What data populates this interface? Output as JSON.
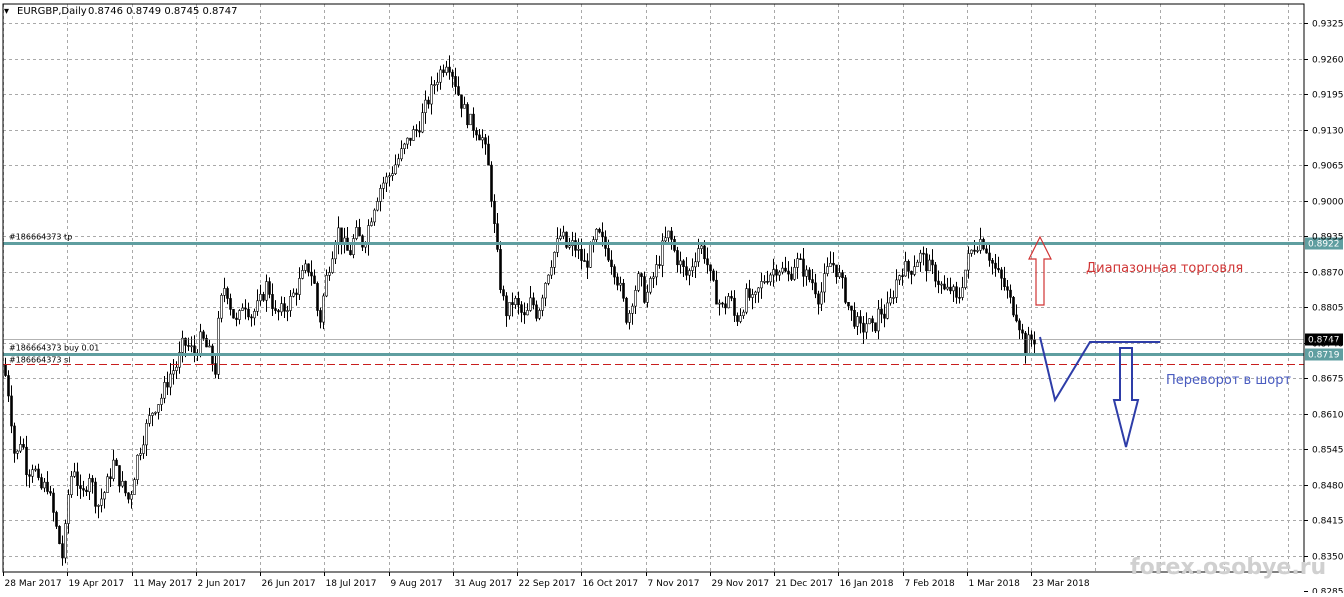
{
  "header": {
    "arrow": "▾",
    "symbol": "EURGBP,Daily",
    "ohlc": "0.8746 0.8749 0.8745 0.8747"
  },
  "watermark": "forex.osobye.ru",
  "annotations": {
    "range_label": "Диапазонная торговля",
    "short_label": "Переворот в шорт"
  },
  "order_labels": {
    "tp": "#186664373 tp",
    "buy": "#186664373 buy 0.01",
    "sl": "#186664373 sl"
  },
  "colors": {
    "background": "#ffffff",
    "grid": "#a9a9a9",
    "candle": "#000000",
    "level_line": "#5f9ea0",
    "sl_line": "#c81e1e",
    "price_tag": "#000000",
    "level_tag": "#5f9ea0",
    "range_label": "#d03434",
    "short_label": "#4a5cc0",
    "drawing_blue": "#2e3da8",
    "drawing_red": "#d03434",
    "watermark": "#c8c8c8"
  },
  "chart_data": {
    "type": "candlestick",
    "symbol": "EURGBP",
    "timeframe": "Daily",
    "ylim": [
      0.832,
      0.936
    ],
    "y_ticks": [
      "0.9325",
      "0.9260",
      "0.9195",
      "0.9130",
      "0.9065",
      "0.9000",
      "0.8935",
      "0.8870",
      "0.8805",
      "0.8740",
      "0.8675",
      "0.8610",
      "0.8545",
      "0.8480",
      "0.8415",
      "0.8350",
      "0.8285"
    ],
    "x_ticks": [
      "28 Mar 2017",
      "19 Apr 2017",
      "11 May 2017",
      "2 Jun 2017",
      "26 Jun 2017",
      "18 Jul 2017",
      "9 Aug 2017",
      "31 Aug 2017",
      "22 Sep 2017",
      "16 Oct 2017",
      "7 Nov 2017",
      "29 Nov 2017",
      "21 Dec 2017",
      "16 Jan 2018",
      "7 Feb 2018",
      "1 Mar 2018",
      "23 Mar 2018"
    ],
    "current_price": "0.8747",
    "levels": [
      {
        "name": "tp",
        "price": 0.8922,
        "tag": "0.8922"
      },
      {
        "name": "buy",
        "price": 0.8719,
        "tag": "0.8719"
      },
      {
        "name": "sl",
        "price": 0.87
      }
    ],
    "path_points": [
      [
        0,
        0.87
      ],
      [
        6,
        0.864
      ],
      [
        12,
        0.852
      ],
      [
        18,
        0.857
      ],
      [
        24,
        0.85
      ],
      [
        30,
        0.852
      ],
      [
        36,
        0.847
      ],
      [
        44,
        0.848
      ],
      [
        54,
        0.839
      ],
      [
        60,
        0.834
      ],
      [
        64,
        0.845
      ],
      [
        70,
        0.852
      ],
      [
        78,
        0.845
      ],
      [
        86,
        0.85
      ],
      [
        94,
        0.844
      ],
      [
        102,
        0.847
      ],
      [
        110,
        0.852
      ],
      [
        118,
        0.848
      ],
      [
        126,
        0.845
      ],
      [
        134,
        0.853
      ],
      [
        142,
        0.858
      ],
      [
        150,
        0.862
      ],
      [
        158,
        0.864
      ],
      [
        166,
        0.868
      ],
      [
        174,
        0.87
      ],
      [
        180,
        0.874
      ],
      [
        186,
        0.873
      ],
      [
        192,
        0.872
      ],
      [
        198,
        0.875
      ],
      [
        206,
        0.872
      ],
      [
        212,
        0.869
      ],
      [
        216,
        0.88
      ],
      [
        222,
        0.885
      ],
      [
        228,
        0.88
      ],
      [
        234,
        0.877
      ],
      [
        240,
        0.882
      ],
      [
        248,
        0.879
      ],
      [
        256,
        0.881
      ],
      [
        264,
        0.885
      ],
      [
        272,
        0.879
      ],
      [
        280,
        0.88
      ],
      [
        288,
        0.882
      ],
      [
        296,
        0.885
      ],
      [
        304,
        0.888
      ],
      [
        310,
        0.886
      ],
      [
        316,
        0.877
      ],
      [
        322,
        0.885
      ],
      [
        328,
        0.89
      ],
      [
        334,
        0.895
      ],
      [
        340,
        0.892
      ],
      [
        346,
        0.89
      ],
      [
        352,
        0.894
      ],
      [
        360,
        0.892
      ],
      [
        366,
        0.896
      ],
      [
        372,
        0.9
      ],
      [
        378,
        0.903
      ],
      [
        384,
        0.904
      ],
      [
        390,
        0.906
      ],
      [
        396,
        0.908
      ],
      [
        402,
        0.91
      ],
      [
        408,
        0.912
      ],
      [
        414,
        0.913
      ],
      [
        420,
        0.916
      ],
      [
        426,
        0.919
      ],
      [
        432,
        0.922
      ],
      [
        438,
        0.924
      ],
      [
        444,
        0.926
      ],
      [
        450,
        0.923
      ],
      [
        456,
        0.919
      ],
      [
        462,
        0.916
      ],
      [
        468,
        0.914
      ],
      [
        474,
        0.913
      ],
      [
        480,
        0.911
      ],
      [
        486,
        0.905
      ],
      [
        492,
        0.893
      ],
      [
        498,
        0.883
      ],
      [
        504,
        0.879
      ],
      [
        510,
        0.882
      ],
      [
        516,
        0.88
      ],
      [
        522,
        0.878
      ],
      [
        528,
        0.882
      ],
      [
        534,
        0.879
      ],
      [
        540,
        0.884
      ],
      [
        546,
        0.888
      ],
      [
        552,
        0.891
      ],
      [
        558,
        0.894
      ],
      [
        564,
        0.891
      ],
      [
        570,
        0.892
      ],
      [
        576,
        0.89
      ],
      [
        582,
        0.888
      ],
      [
        588,
        0.891
      ],
      [
        594,
        0.894
      ],
      [
        600,
        0.892
      ],
      [
        606,
        0.89
      ],
      [
        612,
        0.887
      ],
      [
        618,
        0.883
      ],
      [
        624,
        0.878
      ],
      [
        630,
        0.883
      ],
      [
        636,
        0.886
      ],
      [
        642,
        0.882
      ],
      [
        648,
        0.885
      ],
      [
        654,
        0.888
      ],
      [
        660,
        0.892
      ],
      [
        666,
        0.894
      ],
      [
        672,
        0.89
      ],
      [
        678,
        0.888
      ],
      [
        684,
        0.886
      ],
      [
        690,
        0.889
      ],
      [
        696,
        0.892
      ],
      [
        702,
        0.89
      ],
      [
        708,
        0.885
      ],
      [
        714,
        0.882
      ],
      [
        720,
        0.88
      ],
      [
        726,
        0.883
      ],
      [
        732,
        0.878
      ],
      [
        738,
        0.88
      ],
      [
        744,
        0.883
      ],
      [
        750,
        0.881
      ],
      [
        756,
        0.884
      ],
      [
        762,
        0.886
      ],
      [
        768,
        0.887
      ],
      [
        774,
        0.888
      ],
      [
        780,
        0.887
      ],
      [
        786,
        0.886
      ],
      [
        792,
        0.889
      ],
      [
        798,
        0.888
      ],
      [
        804,
        0.886
      ],
      [
        810,
        0.885
      ],
      [
        816,
        0.882
      ],
      [
        822,
        0.886
      ],
      [
        828,
        0.889
      ],
      [
        834,
        0.887
      ],
      [
        840,
        0.884
      ],
      [
        846,
        0.88
      ],
      [
        852,
        0.878
      ],
      [
        858,
        0.876
      ],
      [
        864,
        0.878
      ],
      [
        870,
        0.876
      ],
      [
        876,
        0.88
      ],
      [
        882,
        0.879
      ],
      [
        888,
        0.882
      ],
      [
        894,
        0.886
      ],
      [
        900,
        0.888
      ],
      [
        906,
        0.887
      ],
      [
        912,
        0.889
      ],
      [
        918,
        0.89
      ],
      [
        924,
        0.888
      ],
      [
        930,
        0.887
      ],
      [
        936,
        0.885
      ],
      [
        942,
        0.883
      ],
      [
        948,
        0.884
      ],
      [
        954,
        0.881
      ],
      [
        960,
        0.886
      ],
      [
        966,
        0.89
      ],
      [
        972,
        0.892
      ],
      [
        978,
        0.893
      ],
      [
        984,
        0.891
      ],
      [
        990,
        0.888
      ],
      [
        996,
        0.886
      ],
      [
        1002,
        0.884
      ],
      [
        1008,
        0.881
      ],
      [
        1014,
        0.879
      ],
      [
        1018,
        0.876
      ],
      [
        1022,
        0.873
      ],
      [
        1026,
        0.8745
      ],
      [
        1032,
        0.8747
      ]
    ]
  }
}
